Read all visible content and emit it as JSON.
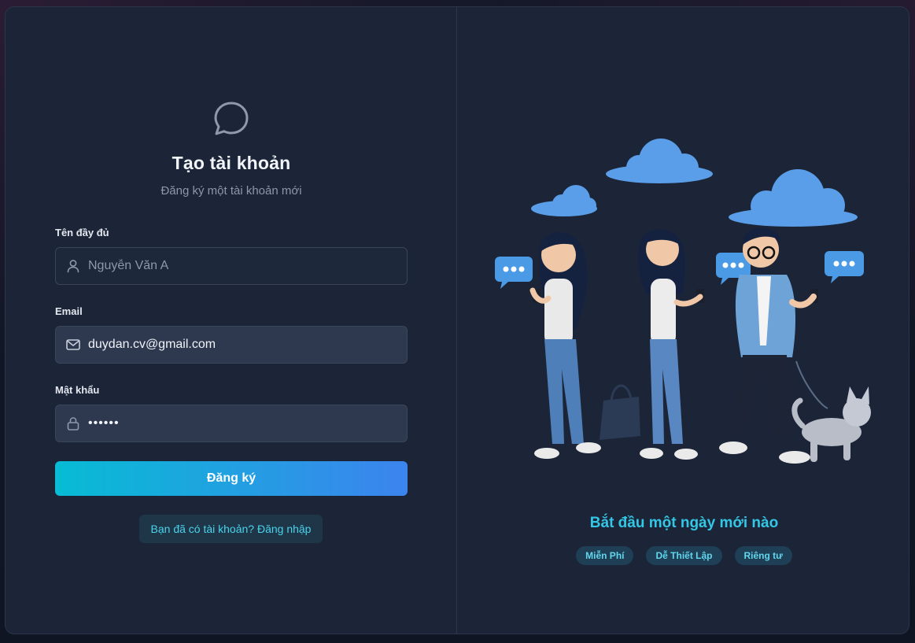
{
  "form": {
    "title": "Tạo tài khoản",
    "subtitle": "Đăng ký một tài khoản mới",
    "name_label": "Tên đầy đủ",
    "name_placeholder": "Nguyễn Văn A",
    "name_value": "",
    "email_label": "Email",
    "email_value": "duydan.cv@gmail.com",
    "password_label": "Mật khẩu",
    "password_value": "••••••",
    "submit_label": "Đăng ký",
    "login_link": "Bạn đã có tài khoản? Đăng nhập"
  },
  "promo": {
    "tagline": "Bắt đầu một ngày mới nào",
    "chips": [
      "Miễn Phí",
      "Dễ Thiết Lập",
      "Riêng tư"
    ]
  },
  "icons": {
    "logo": "chat-bubble-icon",
    "name": "user-icon",
    "email": "mail-icon",
    "password": "lock-icon"
  },
  "colors": {
    "accent": "#34c6e5",
    "button_start": "#07bcd4",
    "button_end": "#3c84ee",
    "card_bg": "#1c2538"
  }
}
